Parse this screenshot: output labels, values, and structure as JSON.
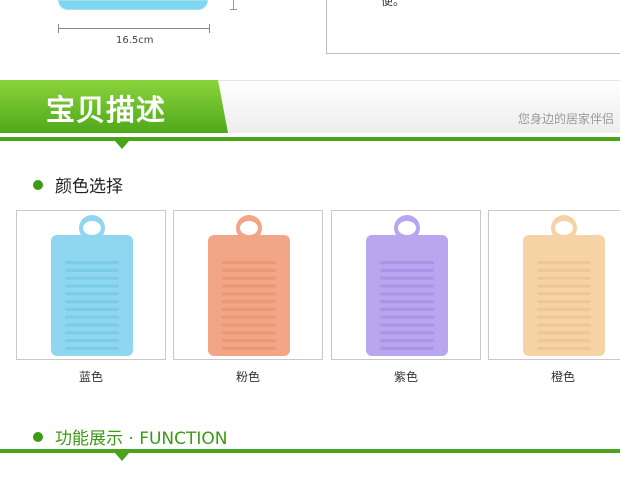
{
  "top": {
    "dimension": "16.5cm",
    "box_text": "便。"
  },
  "banner": {
    "title": "宝贝描述",
    "subtitle": "您身边的居家伴侣"
  },
  "colors_section": {
    "heading": "颜色选择",
    "items": [
      {
        "label": "蓝色",
        "color": "#8fd6f0",
        "stroke": "#6cc5e6"
      },
      {
        "label": "粉色",
        "color": "#f2a687",
        "stroke": "#e58c6a"
      },
      {
        "label": "紫色",
        "color": "#b8a6ee",
        "stroke": "#9c86e2"
      },
      {
        "label": "橙色",
        "color": "#f6d3a5",
        "stroke": "#e8bd86"
      }
    ]
  },
  "function_section": {
    "heading": "功能展示 · FUNCTION"
  },
  "theme": {
    "accent": "#4aa41a"
  }
}
